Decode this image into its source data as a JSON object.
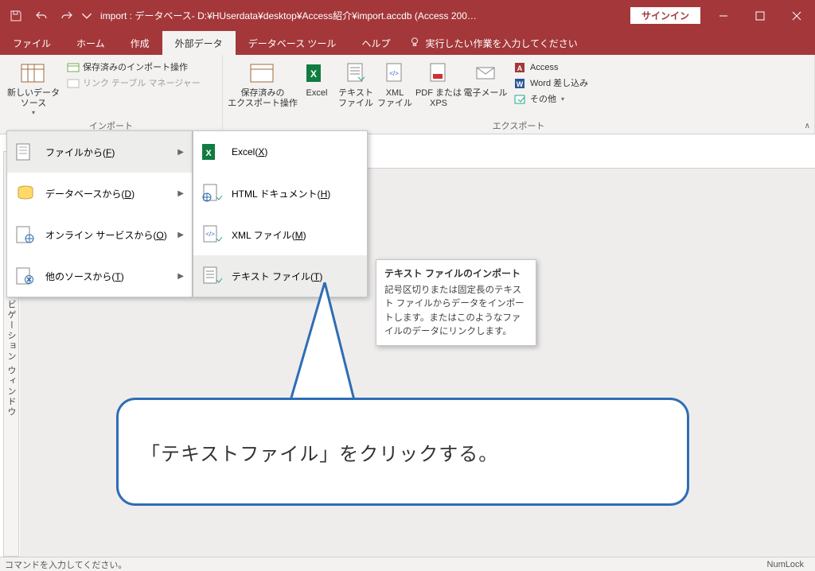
{
  "title_bar": {
    "title": "import : データベース- D:¥HUserdata¥desktop¥Access紹介¥import.accdb (Access 200…",
    "signin": "サインイン"
  },
  "ribbon_tabs": {
    "file": "ファイル",
    "home": "ホーム",
    "create": "作成",
    "external": "外部データ",
    "dbtools": "データベース ツール",
    "help": "ヘルプ",
    "tell_me": "実行したい作業を入力してください"
  },
  "ribbon": {
    "new_data_source": "新しいデータ ソース",
    "saved_import": "保存済みのインポート操作",
    "linked_table_mgr": "リンク テーブル マネージャー",
    "saved_export_l1": "保存済みの",
    "saved_export_l2": "エクスポート操作",
    "excel": "Excel",
    "text_l1": "テキスト",
    "text_l2": "ファイル",
    "xml_l1": "XML",
    "xml_l2": "ファイル",
    "pdf_l1": "PDF または",
    "pdf_l2": "XPS",
    "email": "電子メール",
    "access": "Access",
    "word_merge": "Word 差し込み",
    "more": "その他",
    "group_import": "インポート",
    "group_export": "エクスポート"
  },
  "menu1": {
    "from_file": "ファイルから(F)",
    "from_db": "データベースから(D)",
    "from_online": "オンライン サービスから(O)",
    "from_other": "他のソースから(T)"
  },
  "menu2": {
    "excel": "Excel(X)",
    "html": "HTML ドキュメント(H)",
    "xml": "XML ファイル(M)",
    "text": "テキスト ファイル(T)"
  },
  "tooltip": {
    "title": "テキスト ファイルのインポート",
    "body": "記号区切りまたは固定長のテキスト ファイルからデータをインポートします。またはこのようなファイルのデータにリンクします。"
  },
  "nav_pane": "ナビゲーション ウィンドウ",
  "callout": "「テキストファイル」をクリックする。",
  "status": {
    "left": "コマンドを入力してください。",
    "right": "NumLock"
  }
}
